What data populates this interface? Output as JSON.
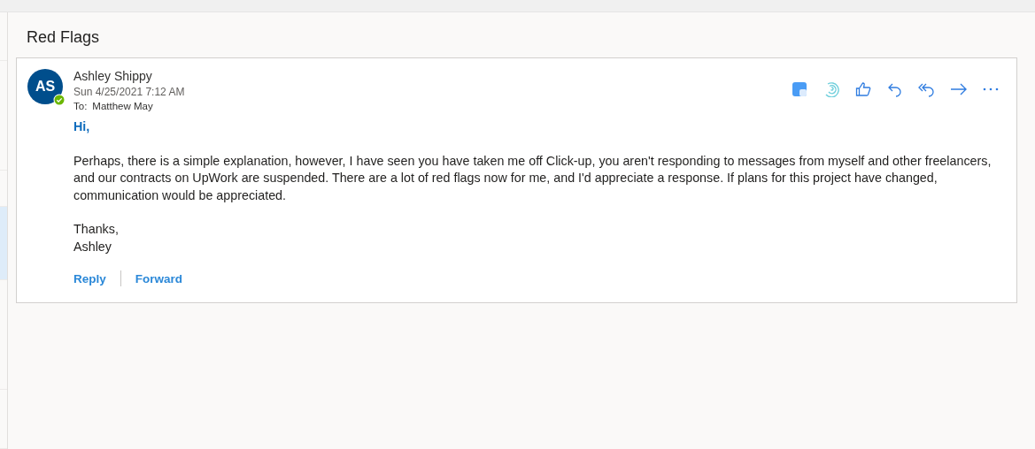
{
  "message_list": [
    {
      "selected": false
    },
    {
      "selected": false
    },
    {
      "selected": false
    },
    {
      "selected": true
    },
    {
      "selected": false
    },
    {
      "selected": false
    }
  ],
  "subject": "Red Flags",
  "message": {
    "avatar_initials": "AS",
    "presence_available": true,
    "sender": "Ashley Shippy",
    "date": "Sun 4/25/2021 7:12 AM",
    "to_label": "To:",
    "to": "Matthew May",
    "body": [
      "Hi,",
      "Perhaps, there is a simple explanation, however, I have seen you have taken me off Click-up, you aren't responding to messages from myself and other freelancers, and our contracts on UpWork are suspended. There are a lot of red flags now for me, and I'd appreciate a response. If plans for this project have changed, communication would be appreciated.",
      "Thanks,\nAshley"
    ],
    "links": [
      "Reply",
      "Forward"
    ]
  }
}
